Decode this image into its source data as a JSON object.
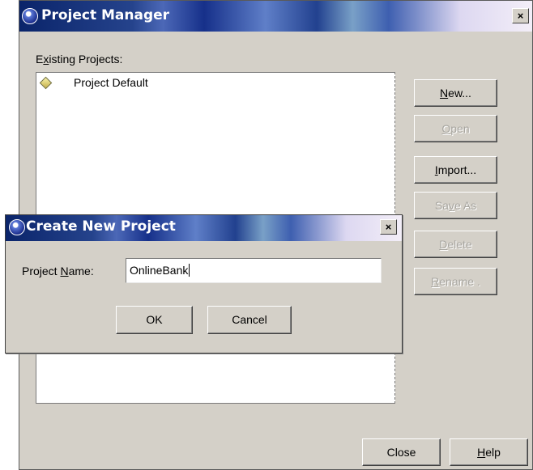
{
  "main_window": {
    "title": "Project Manager",
    "close_glyph": "×",
    "existing_projects_label_prefix": "E",
    "existing_projects_label_accel": "x",
    "existing_projects_label_rest": "isting Projects:",
    "projects": [
      {
        "name": "Project Default",
        "icon": "project-diamond-icon"
      }
    ],
    "buttons": {
      "new": {
        "accel": "N",
        "rest": "ew...",
        "enabled": true
      },
      "open": {
        "accel": "O",
        "rest": "pen",
        "enabled": false
      },
      "import": {
        "accel": "I",
        "rest": "mport...",
        "enabled": true
      },
      "save_as_pre": "Sa",
      "save_as_accel": "v",
      "save_as_post": "e As",
      "delete": {
        "accel": "D",
        "rest": "elete",
        "enabled": false
      },
      "rename": {
        "accel": "R",
        "rest": "ename .",
        "enabled": false
      },
      "close": "Close",
      "help": {
        "accel": "H",
        "rest": "elp"
      }
    }
  },
  "dialog": {
    "title": "Create New Project",
    "close_glyph": "×",
    "name_label_pre": "Project ",
    "name_label_accel": "N",
    "name_label_post": "ame:",
    "name_value": "OnlineBank",
    "ok": "OK",
    "cancel": "Cancel"
  },
  "colors": {
    "window_bg": "#d4d0c8",
    "title_dark": "#0a246a",
    "disabled_text": "#a8a6a0"
  }
}
